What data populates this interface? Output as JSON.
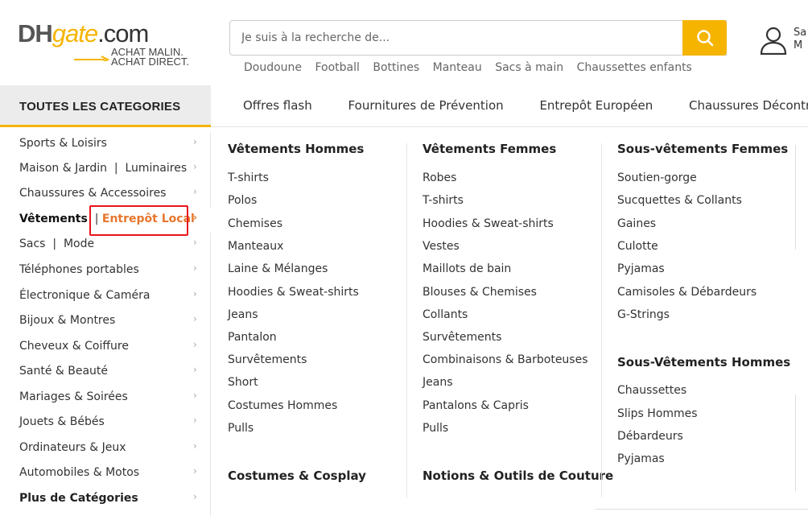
{
  "logo": {
    "dh": "DH",
    "gate": "gate",
    "com": ".com",
    "tag1": "ACHAT MALIN.",
    "tag2": "ACHAT DIRECT."
  },
  "search": {
    "placeholder": "Je suis à la recherche de...",
    "value": ""
  },
  "hot_searches": [
    "Doudoune",
    "Football",
    "Bottines",
    "Manteau",
    "Sacs à main",
    "Chaussettes enfants"
  ],
  "user": {
    "line1": "Sa",
    "line2": "M"
  },
  "nav": {
    "all_categories": "TOUTES LES CATEGORIES",
    "links": [
      "Offres flash",
      "Fournitures de Prévention",
      "Entrepôt Européen",
      "Chaussures Décontrac"
    ]
  },
  "sidebar": {
    "items": [
      "Sports & Loisirs",
      "Maison & Jardin  |  Luminaires",
      "Chaussures & Accessoires",
      "Vêtements",
      "Sacs  |  Mode",
      "Téléphones portables",
      "Électronique & Caméra",
      "Bijoux & Montres",
      "Cheveux & Coiffure",
      "Santé & Beauté",
      "Mariages & Soirées",
      "Jouets & Bébés",
      "Ordinateurs & Jeux",
      "Automobiles & Motos",
      "Plus de Catégories"
    ],
    "active_extra": "Entrepôt Local",
    "chevron": "›"
  },
  "menu": {
    "col1": {
      "title": "Vêtements Hommes",
      "links": [
        "T-shirts",
        "Polos",
        "Chemises",
        "Manteaux",
        "Laine & Mélanges",
        "Hoodies & Sweat-shirts",
        "Jeans",
        "Pantalon",
        "Survêtements",
        "Short",
        "Costumes Hommes",
        "Pulls"
      ],
      "title2": "Costumes & Cosplay"
    },
    "col2": {
      "title": "Vêtements Femmes",
      "links": [
        "Robes",
        "T-shirts",
        "Hoodies & Sweat-shirts",
        "Vestes",
        "Maillots de bain",
        "Blouses & Chemises",
        "Collants",
        "Survêtements",
        "Combinaisons & Barboteuses",
        "Jeans",
        "Pantalons & Capris",
        "Pulls"
      ],
      "title2": "Notions & Outils de Couture"
    },
    "col3": {
      "title": "Sous-vêtements Femmes",
      "links": [
        "Soutien-gorge",
        "Sucquettes & Collants",
        "Gaines",
        "Culotte",
        "Pyjamas",
        "Camisoles & Débardeurs",
        "G-Strings"
      ],
      "title2": "Sous-Vêtements Hommes",
      "links2": [
        "Chaussettes",
        "Slips Hommes",
        "Débardeurs",
        "Pyjamas"
      ]
    }
  },
  "colors": {
    "accent": "#f5b400",
    "highlight": "#e6762d",
    "annotation": "#e8151c"
  }
}
